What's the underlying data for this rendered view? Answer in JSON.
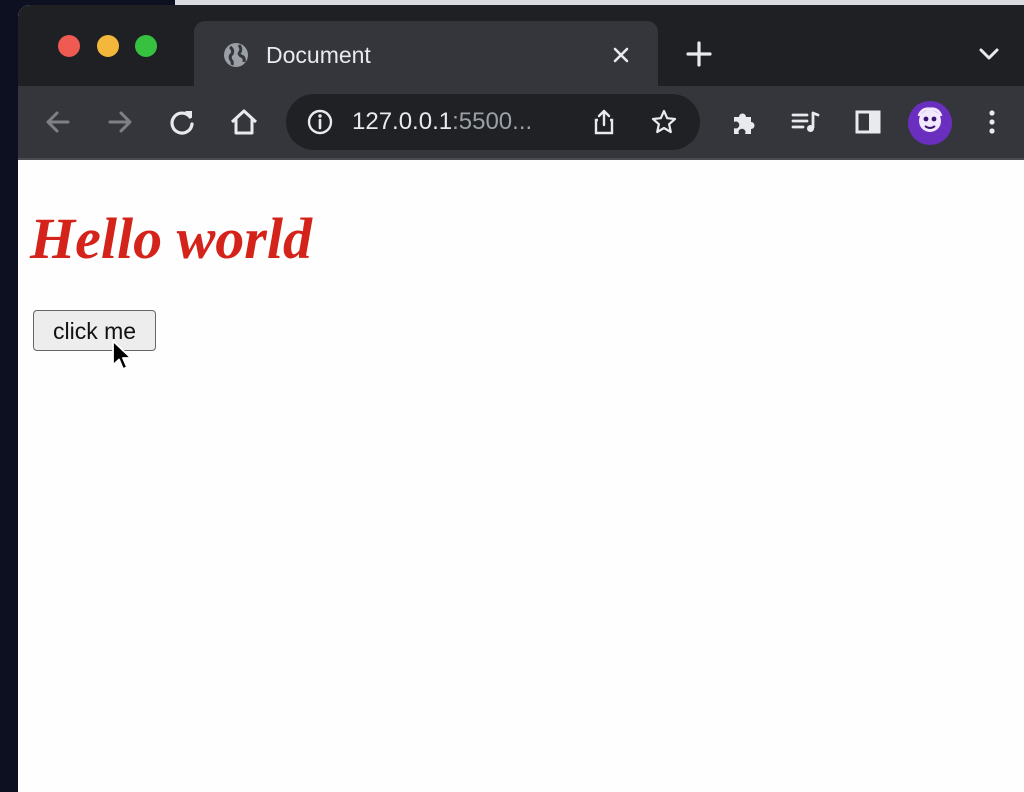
{
  "browser": {
    "tab": {
      "title": "Document"
    },
    "address_bar": {
      "host": "127.0.0.1",
      "rest": ":5500..."
    },
    "colors": {
      "frame": "#1f2024",
      "toolbar": "#35363b",
      "omnibox": "#202124",
      "avatar": "#6b2fbf"
    }
  },
  "page": {
    "heading": "Hello world",
    "button_label": "click me",
    "heading_color": "#d4231a"
  }
}
